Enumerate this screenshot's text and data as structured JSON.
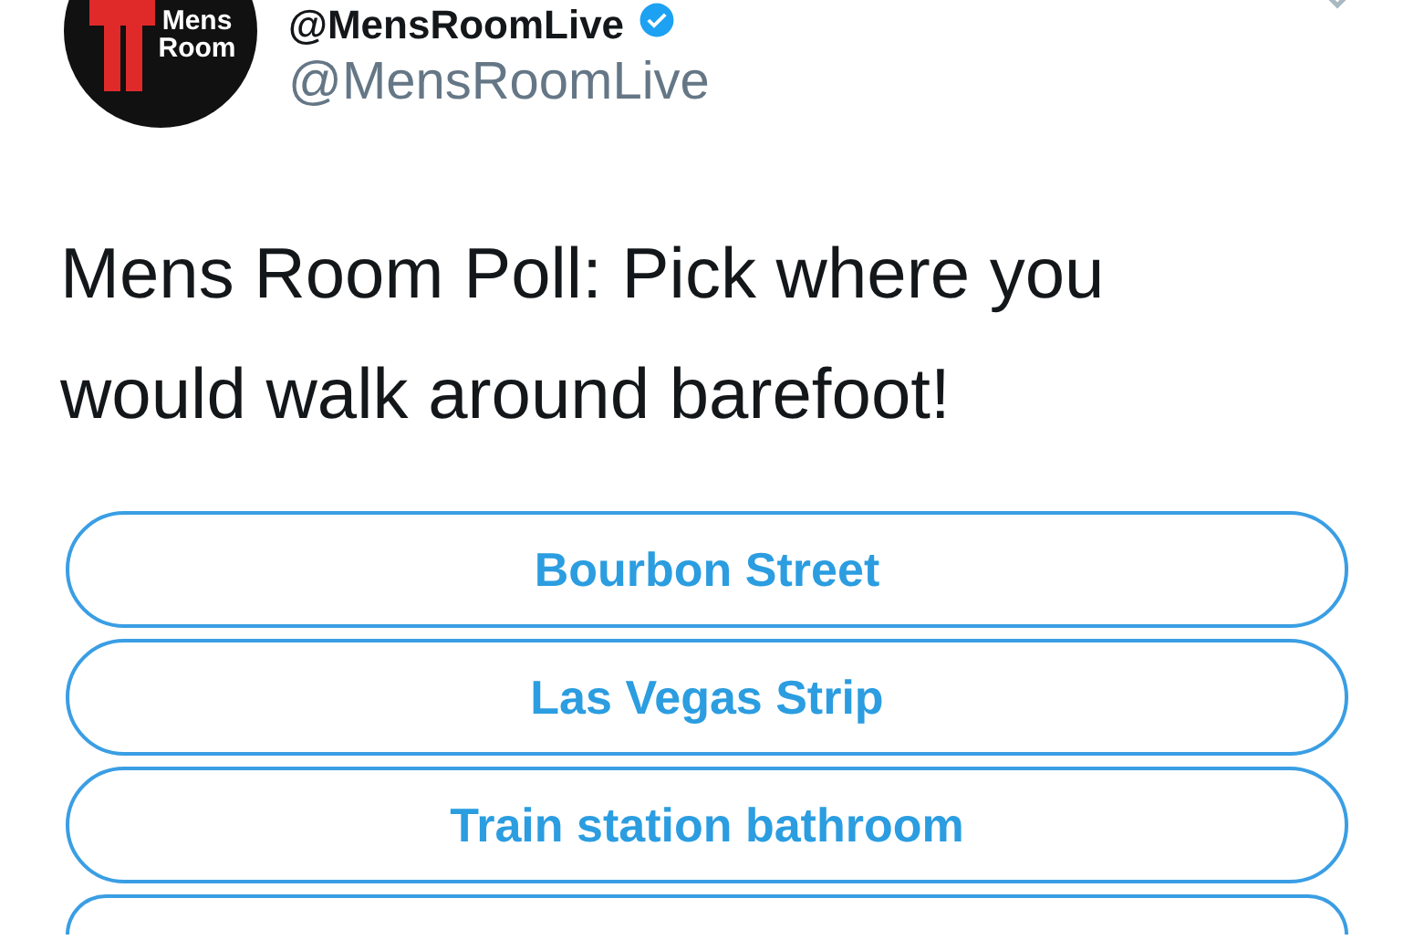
{
  "tweet": {
    "display_name": "@MensRoomLive",
    "verified": true,
    "handle": "@MensRoomLive",
    "avatar_text": [
      "Mens",
      "Room"
    ],
    "text": "Mens Room Poll: Pick where you would walk around barefoot!"
  },
  "poll": {
    "options": [
      {
        "label": "Bourbon Street"
      },
      {
        "label": "Las Vegas Strip"
      },
      {
        "label": "Train station bathroom"
      },
      {
        "kind": "cut"
      }
    ]
  }
}
